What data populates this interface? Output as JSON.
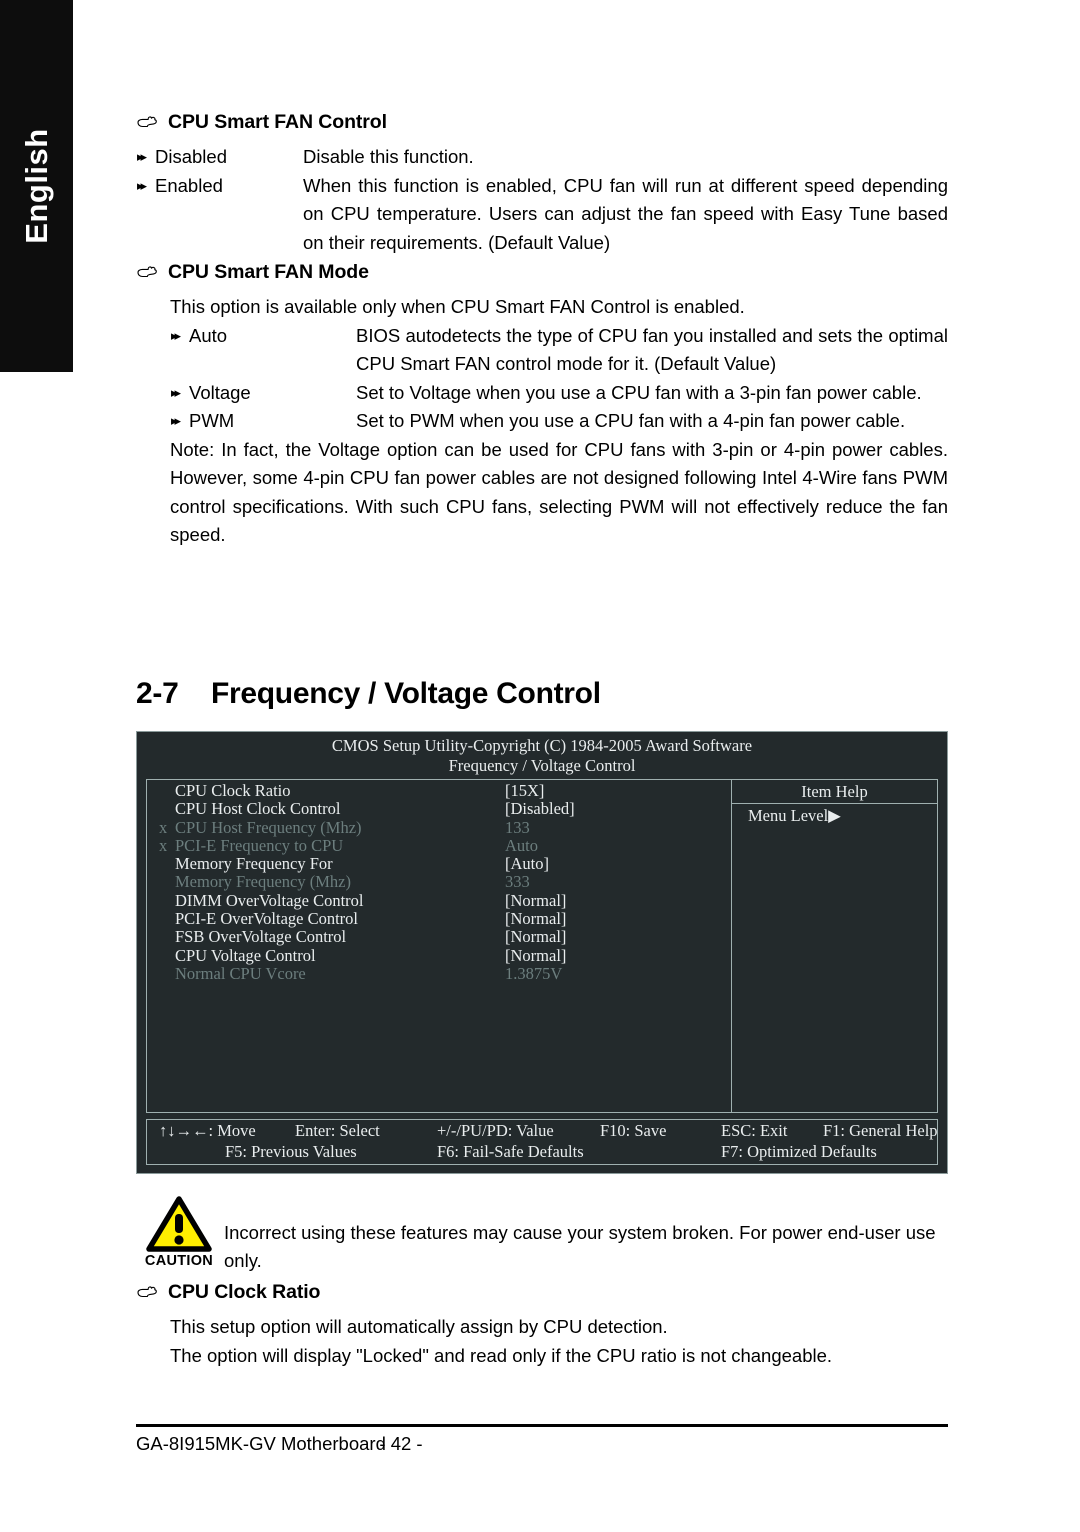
{
  "sidebar": {
    "language_tab": "English"
  },
  "sections": {
    "smart_fan_control": {
      "heading": "CPU Smart FAN Control",
      "options": [
        {
          "mark": "▸▸",
          "term": "Disabled",
          "desc": "Disable this function."
        },
        {
          "mark": "▸▸",
          "term": "Enabled",
          "desc": "When this function is enabled, CPU fan will run at different speed depending on CPU temperature. Users can adjust the fan speed with Easy Tune based on their requirements. (Default Value)"
        }
      ]
    },
    "smart_fan_mode": {
      "heading": "CPU Smart FAN Mode",
      "intro": "This option is available only when CPU Smart FAN Control is enabled.",
      "options": [
        {
          "mark": "▸▸",
          "term": "Auto",
          "desc": "BIOS autodetects the type of CPU fan you installed and sets the optimal CPU Smart FAN control mode for it. (Default Value)"
        },
        {
          "mark": "▸▸",
          "term": "Voltage",
          "desc": "Set to Voltage when you use a CPU fan with a 3-pin fan power cable."
        },
        {
          "mark": "▸▸",
          "term": "PWM",
          "desc": "Set to PWM when you use a CPU fan with a 4-pin fan power cable."
        }
      ],
      "note": "Note: In fact, the Voltage option can be used for CPU fans with 3-pin or 4-pin power cables. However, some 4-pin CPU fan power cables are not designed following Intel 4-Wire fans PWM control specifications. With such CPU fans, selecting PWM will not effectively reduce the fan speed."
    },
    "frequency_voltage": {
      "number": "2-7",
      "title": "Frequency / Voltage Control"
    },
    "cpu_clock_ratio": {
      "heading": "CPU Clock Ratio",
      "lines": [
        "This setup option will automatically assign by CPU detection.",
        "The option will display \"Locked\" and read only if the CPU ratio is not changeable."
      ]
    }
  },
  "bios": {
    "title": "CMOS Setup Utility-Copyright (C) 1984-2005 Award Software",
    "subtitle": "Frequency / Voltage Control",
    "rows": [
      {
        "x": "",
        "label": "CPU Clock Ratio",
        "value": "[15X]",
        "dim": false
      },
      {
        "x": "",
        "label": "CPU Host Clock Control",
        "value": "[Disabled]",
        "dim": false
      },
      {
        "x": "x",
        "label": "CPU Host Frequency (Mhz)",
        "value": "133",
        "dim": true
      },
      {
        "x": "x",
        "label": "PCI-E Frequency to CPU",
        "value": "Auto",
        "dim": true
      },
      {
        "x": "",
        "label": "Memory Frequency For",
        "value": "[Auto]",
        "dim": false
      },
      {
        "x": "",
        "label": "Memory Frequency (Mhz)",
        "value": "333",
        "dim": true
      },
      {
        "x": "",
        "label": "DIMM OverVoltage Control",
        "value": "[Normal]",
        "dim": false
      },
      {
        "x": "",
        "label": "PCI-E OverVoltage Control",
        "value": "[Normal]",
        "dim": false
      },
      {
        "x": "",
        "label": "FSB OverVoltage Control",
        "value": "[Normal]",
        "dim": false
      },
      {
        "x": "",
        "label": "CPU Voltage Control",
        "value": "[Normal]",
        "dim": false
      },
      {
        "x": "",
        "label": "Normal CPU Vcore",
        "value": "1.3875V",
        "dim": true
      }
    ],
    "help": {
      "header": "Item Help",
      "menu_level": "Menu Level▶"
    },
    "keys": {
      "move": "↑↓→←: Move",
      "enter": "Enter: Select",
      "value": "+/-/PU/PD: Value",
      "save": "F10: Save",
      "exit": "ESC: Exit",
      "general_help": "F1: General Help",
      "previous": "F5: Previous Values",
      "failsafe": "F6: Fail-Safe Defaults",
      "optimized": "F7: Optimized Defaults"
    },
    "colors": {
      "background": "#232a2c",
      "border": "#9fb0b0",
      "text": "#e9edee",
      "dim_text": "#6c7e7e"
    }
  },
  "caution": {
    "label": "CAUTION",
    "text": "Incorrect using these features may cause your system broken. For power end-user use only.",
    "color": "#ffee00"
  },
  "footer": {
    "left": "GA-8I915MK-GV Motherboard",
    "page": "- 42 -"
  }
}
